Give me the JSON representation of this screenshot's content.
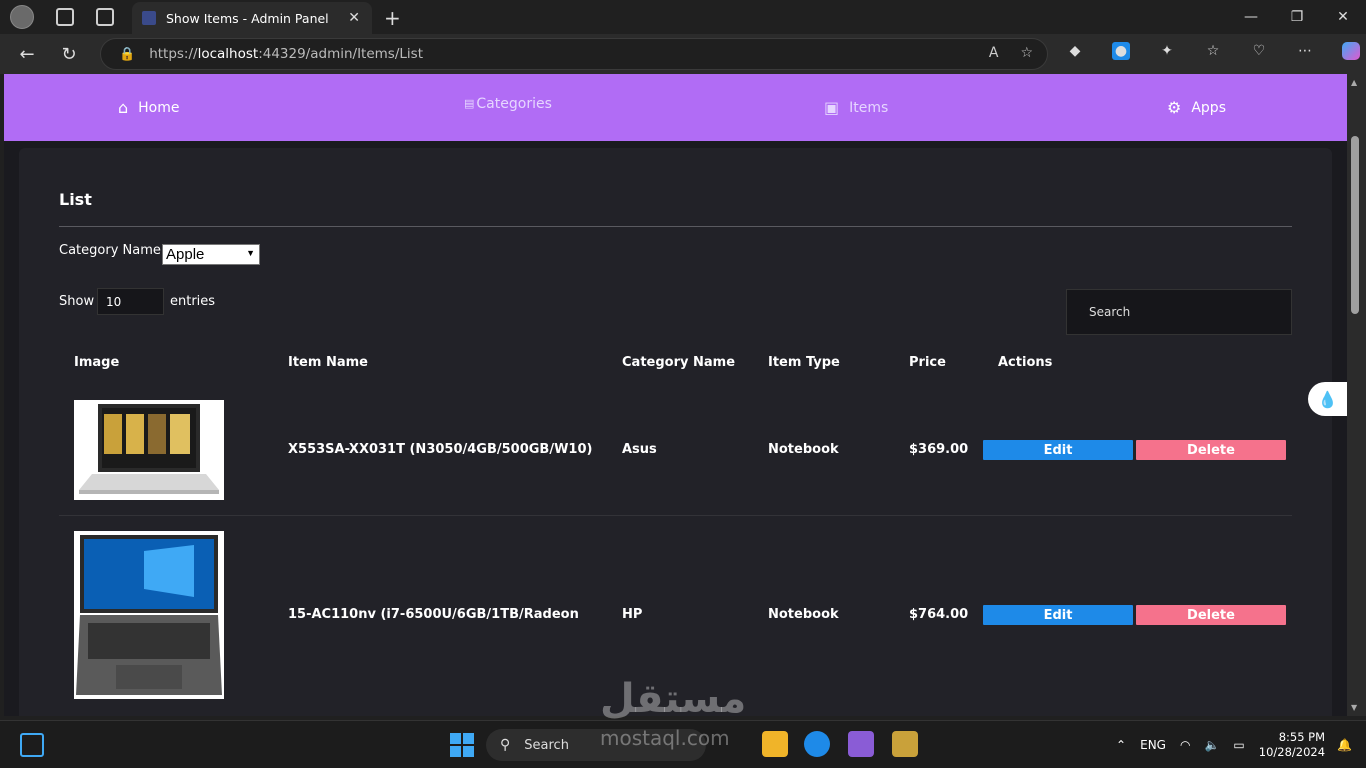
{
  "browser": {
    "tab_title": "Show Items - Admin Panel",
    "url_prefix": "https://",
    "url_host": "localhost",
    "url_rest": ":44329/admin/Items/List"
  },
  "nav": {
    "home": "Home",
    "categories": "Categories",
    "items": "Items",
    "apps": "Apps"
  },
  "list": {
    "title": "List",
    "category_label": "Category Name",
    "category_selected": "Apple",
    "show_label": "Show",
    "show_value": "10",
    "entries_label": "entries",
    "search_placeholder": "Search"
  },
  "table": {
    "headers": [
      "Image",
      "Item Name",
      "Category Name",
      "Item Type",
      "Price",
      "Actions"
    ],
    "rows": [
      {
        "name": "X553SA-XX031T (N3050/4GB/500GB/W10)",
        "category": "Asus",
        "type": "Notebook",
        "price": "$369.00",
        "edit": "Edit",
        "delete": "Delete"
      },
      {
        "name": "15-AC110nv (i7-6500U/6GB/1TB/Radeon",
        "category": "HP",
        "type": "Notebook",
        "price": "$764.00",
        "edit": "Edit",
        "delete": "Delete"
      }
    ]
  },
  "taskbar": {
    "search": "Search",
    "lang": "ENG",
    "time": "8:55 PM",
    "date": "10/28/2024"
  },
  "watermark": {
    "arabic": "مستقل",
    "latin": "mostaql.com"
  }
}
